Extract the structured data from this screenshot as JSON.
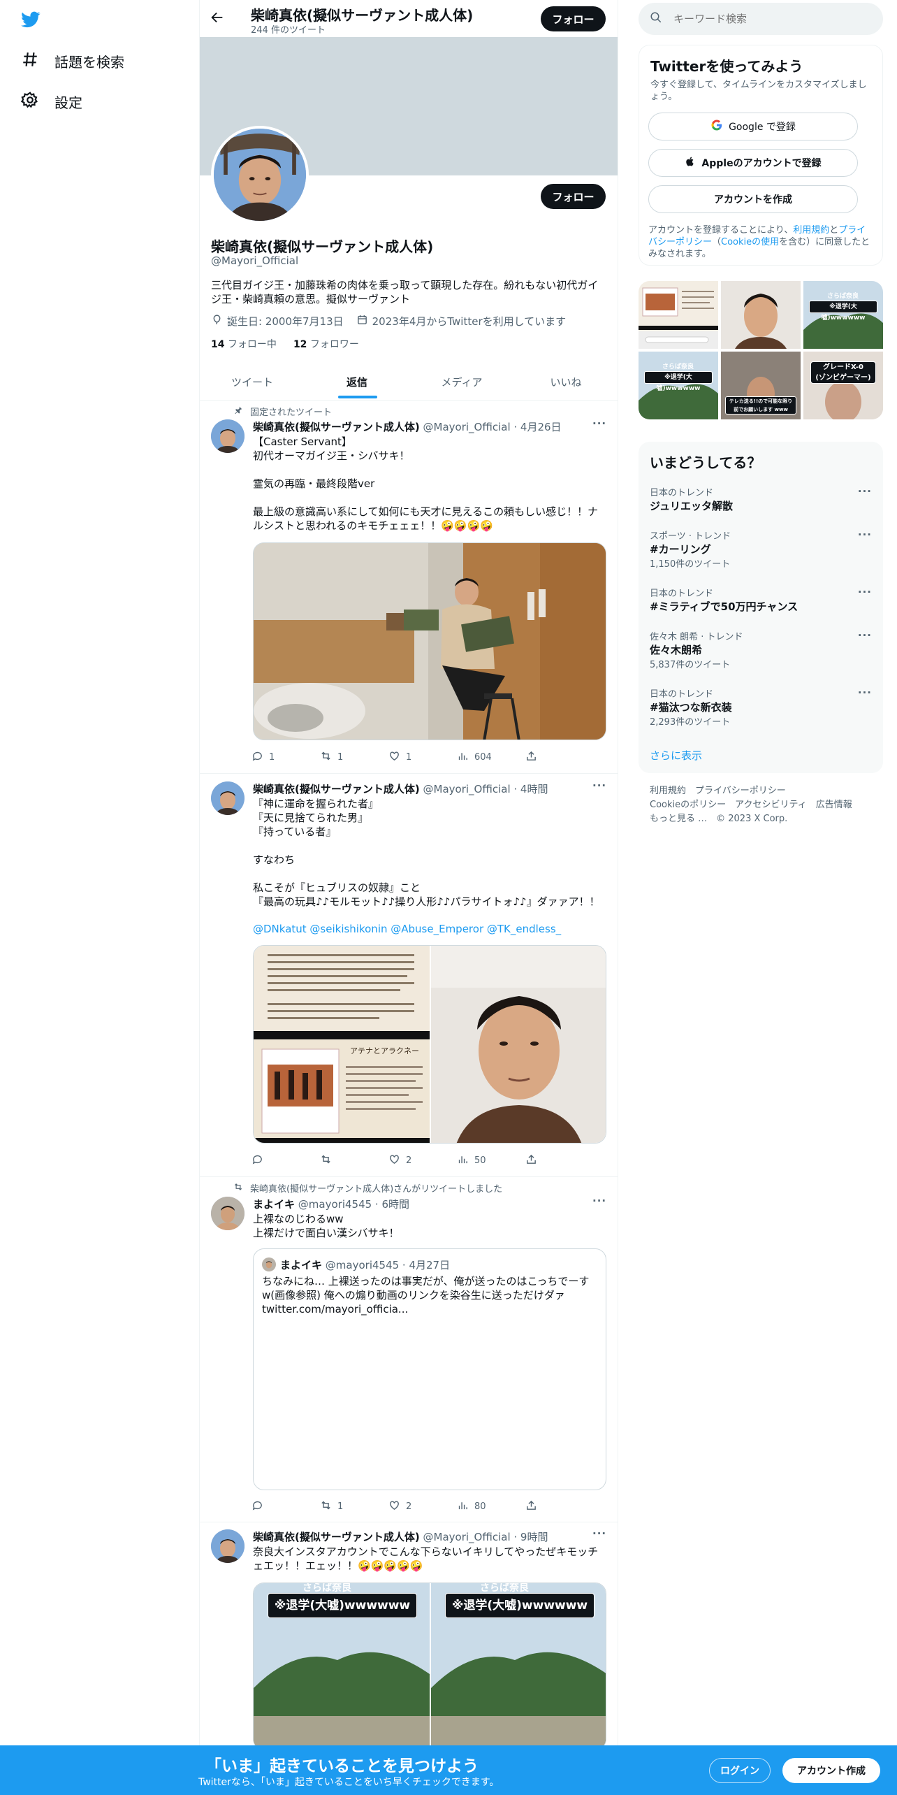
{
  "nav": {
    "explore_label": "話題を検索",
    "settings_label": "設定"
  },
  "header": {
    "title": "柴崎真依(擬似サーヴァント成人体)",
    "tweet_count": "244 件のツイート",
    "follow_label": "フォロー"
  },
  "profile": {
    "name": "柴崎真依(擬似サーヴァント成人体)",
    "handle": "@Mayori_Official",
    "bio": "三代目ガイジ王・加藤珠希の肉体を乗っ取って顕現した存在。紛れもない初代ガイジ王・柴崎真頼の意思。擬似サーヴァント",
    "birthday": "誕生日: 2000年7月13日",
    "joined": "2023年4月からTwitterを利用しています",
    "following_count": "14",
    "following_label": "フォロー中",
    "followers_count": "12",
    "followers_label": "フォロワー",
    "follow_label": "フォロー"
  },
  "tabs": [
    "ツイート",
    "返信",
    "メディア",
    "いいね"
  ],
  "tweets": [
    {
      "pinned_label": "固定されたツイート",
      "name": "柴崎真依(擬似サーヴァント成人体)",
      "meta": "@Mayori_Official · 4月26日",
      "body": "【Caster Servant】\n初代オーマガイジ王・シバサキ！\n\n霊気の再臨・最終段階ver\n\n最上級の意識高い系にして如何にも天才に見えるこの頼もしい感じ！！ナルシストと思われるのキモチェェェ！！🤪🤪🤪🤪",
      "replies": "1",
      "retweets": "1",
      "likes": "1",
      "views": "604"
    },
    {
      "name": "柴崎真依(擬似サーヴァント成人体)",
      "meta": "@Mayori_Official · 4時間",
      "body": "『神に運命を握られた者』\n『天に見捨てられた男』\n『持っている者』\n\nすなわち\n\n私こそが『ヒュブリスの奴隷』こと\n『最高の玩具♪♪モルモット♪♪操り人形♪♪パラサイトォ♪♪』ダァァア！！",
      "mentions": "@DNkatut @seikishikonin @Abuse_Emperor @TK_endless_",
      "img_title": "アテナとアラクネー",
      "replies": "",
      "retweets": "",
      "likes": "2",
      "views": "50"
    },
    {
      "retweet_label": "柴崎真依(擬似サーヴァント成人体)さんがリツイートしました",
      "name": "まよイキ",
      "meta": "@mayori4545 · 6時間",
      "body": "上裸なのじわるww\n上裸だけで面白い漢シバサキ！",
      "quote_name": "まよイキ",
      "quote_meta": "@mayori4545 · 4月27日",
      "quote_body": "ちなみにね… 上裸送ったのは事実だが、俺が送ったのはこっちでーすw(画像参照) 俺への煽り動画のリンクを染谷生に送っただけダァ twitter.com/mayori_officia...",
      "replies": "",
      "retweets": "1",
      "likes": "2",
      "views": "80"
    },
    {
      "name": "柴崎真依(擬似サーヴァント成人体)",
      "meta": "@Mayori_Official · 9時間",
      "body": "奈良大インスタアカウントでこんな下らないイキリしてやったぜキモッチェエッ！！エェッ！！🤪🤪🤪🤪🤪",
      "img_caption_top": "さらば奈良",
      "img_caption": "※退学(大嘘)wwwwww"
    }
  ],
  "search": {
    "placeholder": "キーワード検索"
  },
  "signup": {
    "title": "Twitterを使ってみよう",
    "subtitle": "今すぐ登録して、タイムラインをカスタマイズしましょう。",
    "google_label": "Google で登録",
    "apple_label": "Appleのアカウントで登録",
    "create_label": "アカウントを作成",
    "legal_prefix": "アカウントを登録することにより、",
    "terms_link": "利用規約",
    "legal_and": "と",
    "privacy_link": "プライバシーポリシー",
    "legal_mid": "（",
    "cookie_link": "Cookieの使用",
    "legal_suffix": "を含む）に同意したとみなされます。"
  },
  "media_grid": {
    "caption_top": "さらば奈良",
    "caption_main": "※退学(大嘘)wwwwww",
    "caption_grade": "グレードX-0\n(ゾンビゲーマー)",
    "caption_tiny": "テレカ送る!!ので可能な限り\n前でお願いします www"
  },
  "trends": {
    "title": "いまどうしてる？",
    "items": [
      {
        "category": "日本のトレンド",
        "name": "ジュリエッタ解散",
        "count": ""
      },
      {
        "category": "スポーツ · トレンド",
        "name": "#カーリング",
        "count": "1,150件のツイート"
      },
      {
        "category": "日本のトレンド",
        "name": "#ミラティブで50万円チャンス",
        "count": ""
      },
      {
        "category": "佐々木 朗希 · トレンド",
        "name": "佐々木朗希",
        "count": "5,837件のツイート"
      },
      {
        "category": "日本のトレンド",
        "name": "#猫汰つな新衣装",
        "count": "2,293件のツイート"
      }
    ],
    "more_label": "さらに表示"
  },
  "footer": {
    "line1": "利用規約　プライバシーポリシー",
    "line2": "Cookieのポリシー　アクセシビリティ　広告情報",
    "line3": "もっと見る …　© 2023 X Corp."
  },
  "bottom_bar": {
    "title": "「いま」起きていることを見つけよう",
    "subtitle": "Twitterなら、「いま」起きていることをいち早くチェックできます。",
    "login_label": "ログイン",
    "signup_label": "アカウント作成"
  },
  "colors": {
    "accent": "#1d9bf0",
    "dark": "#0f1419",
    "muted": "#536471",
    "banner": "#cfd9de"
  }
}
